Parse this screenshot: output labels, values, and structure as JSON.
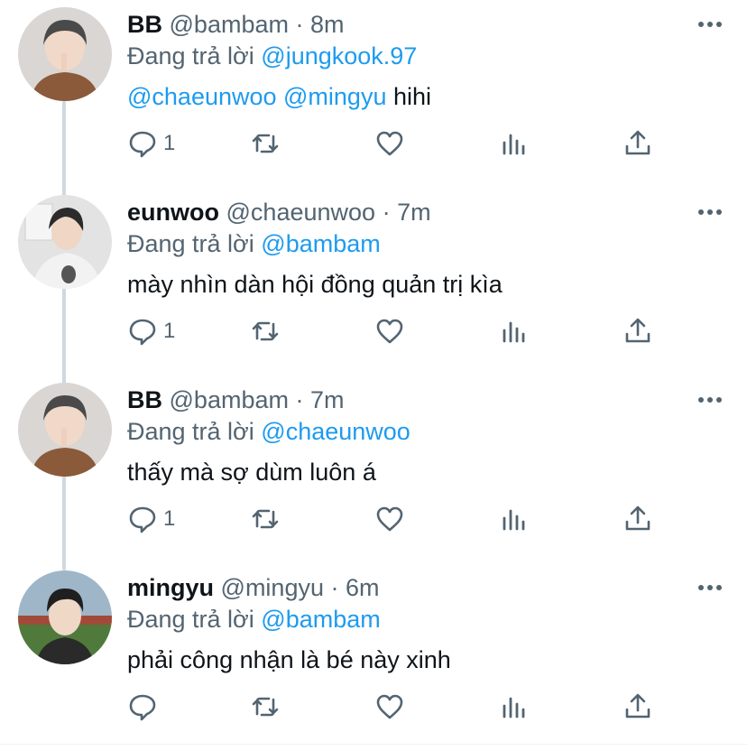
{
  "tweets": [
    {
      "name": "BB",
      "handle": "@bambam",
      "separator": "·",
      "time": "8m",
      "replying_prefix": "Đang trả lời",
      "replying_to": "@jungkook.97",
      "text_mentions": "@chaeunwoo @mingyu",
      "text": " hihi",
      "reply_count": "1",
      "avatar_icon": "avatar-bb"
    },
    {
      "name": "eunwoo",
      "handle": "@chaeunwoo",
      "separator": "·",
      "time": "7m",
      "replying_prefix": "Đang trả lời",
      "replying_to": "@bambam",
      "text_mentions": "",
      "text": "mày nhìn dàn hội đồng quản trị kìa",
      "reply_count": "1",
      "avatar_icon": "avatar-eunwoo"
    },
    {
      "name": "BB",
      "handle": "@bambam",
      "separator": "·",
      "time": "7m",
      "replying_prefix": "Đang trả lời",
      "replying_to": "@chaeunwoo",
      "text_mentions": "",
      "text": "thấy mà sợ dùm luôn á",
      "reply_count": "1",
      "avatar_icon": "avatar-bb"
    },
    {
      "name": "mingyu",
      "handle": "@mingyu",
      "separator": "·",
      "time": "6m",
      "replying_prefix": "Đang trả lời",
      "replying_to": "@bambam",
      "text_mentions": "",
      "text": "phải công nhận là bé này xinh",
      "reply_count": "",
      "avatar_icon": "avatar-mingyu"
    }
  ],
  "colors": {
    "link": "#1d9bf0",
    "muted": "#536471",
    "text": "#0f1419",
    "thread_line": "#cfd9de"
  },
  "icons": [
    "reply-icon",
    "retweet-icon",
    "like-icon",
    "stats-icon",
    "share-icon",
    "more-icon"
  ]
}
